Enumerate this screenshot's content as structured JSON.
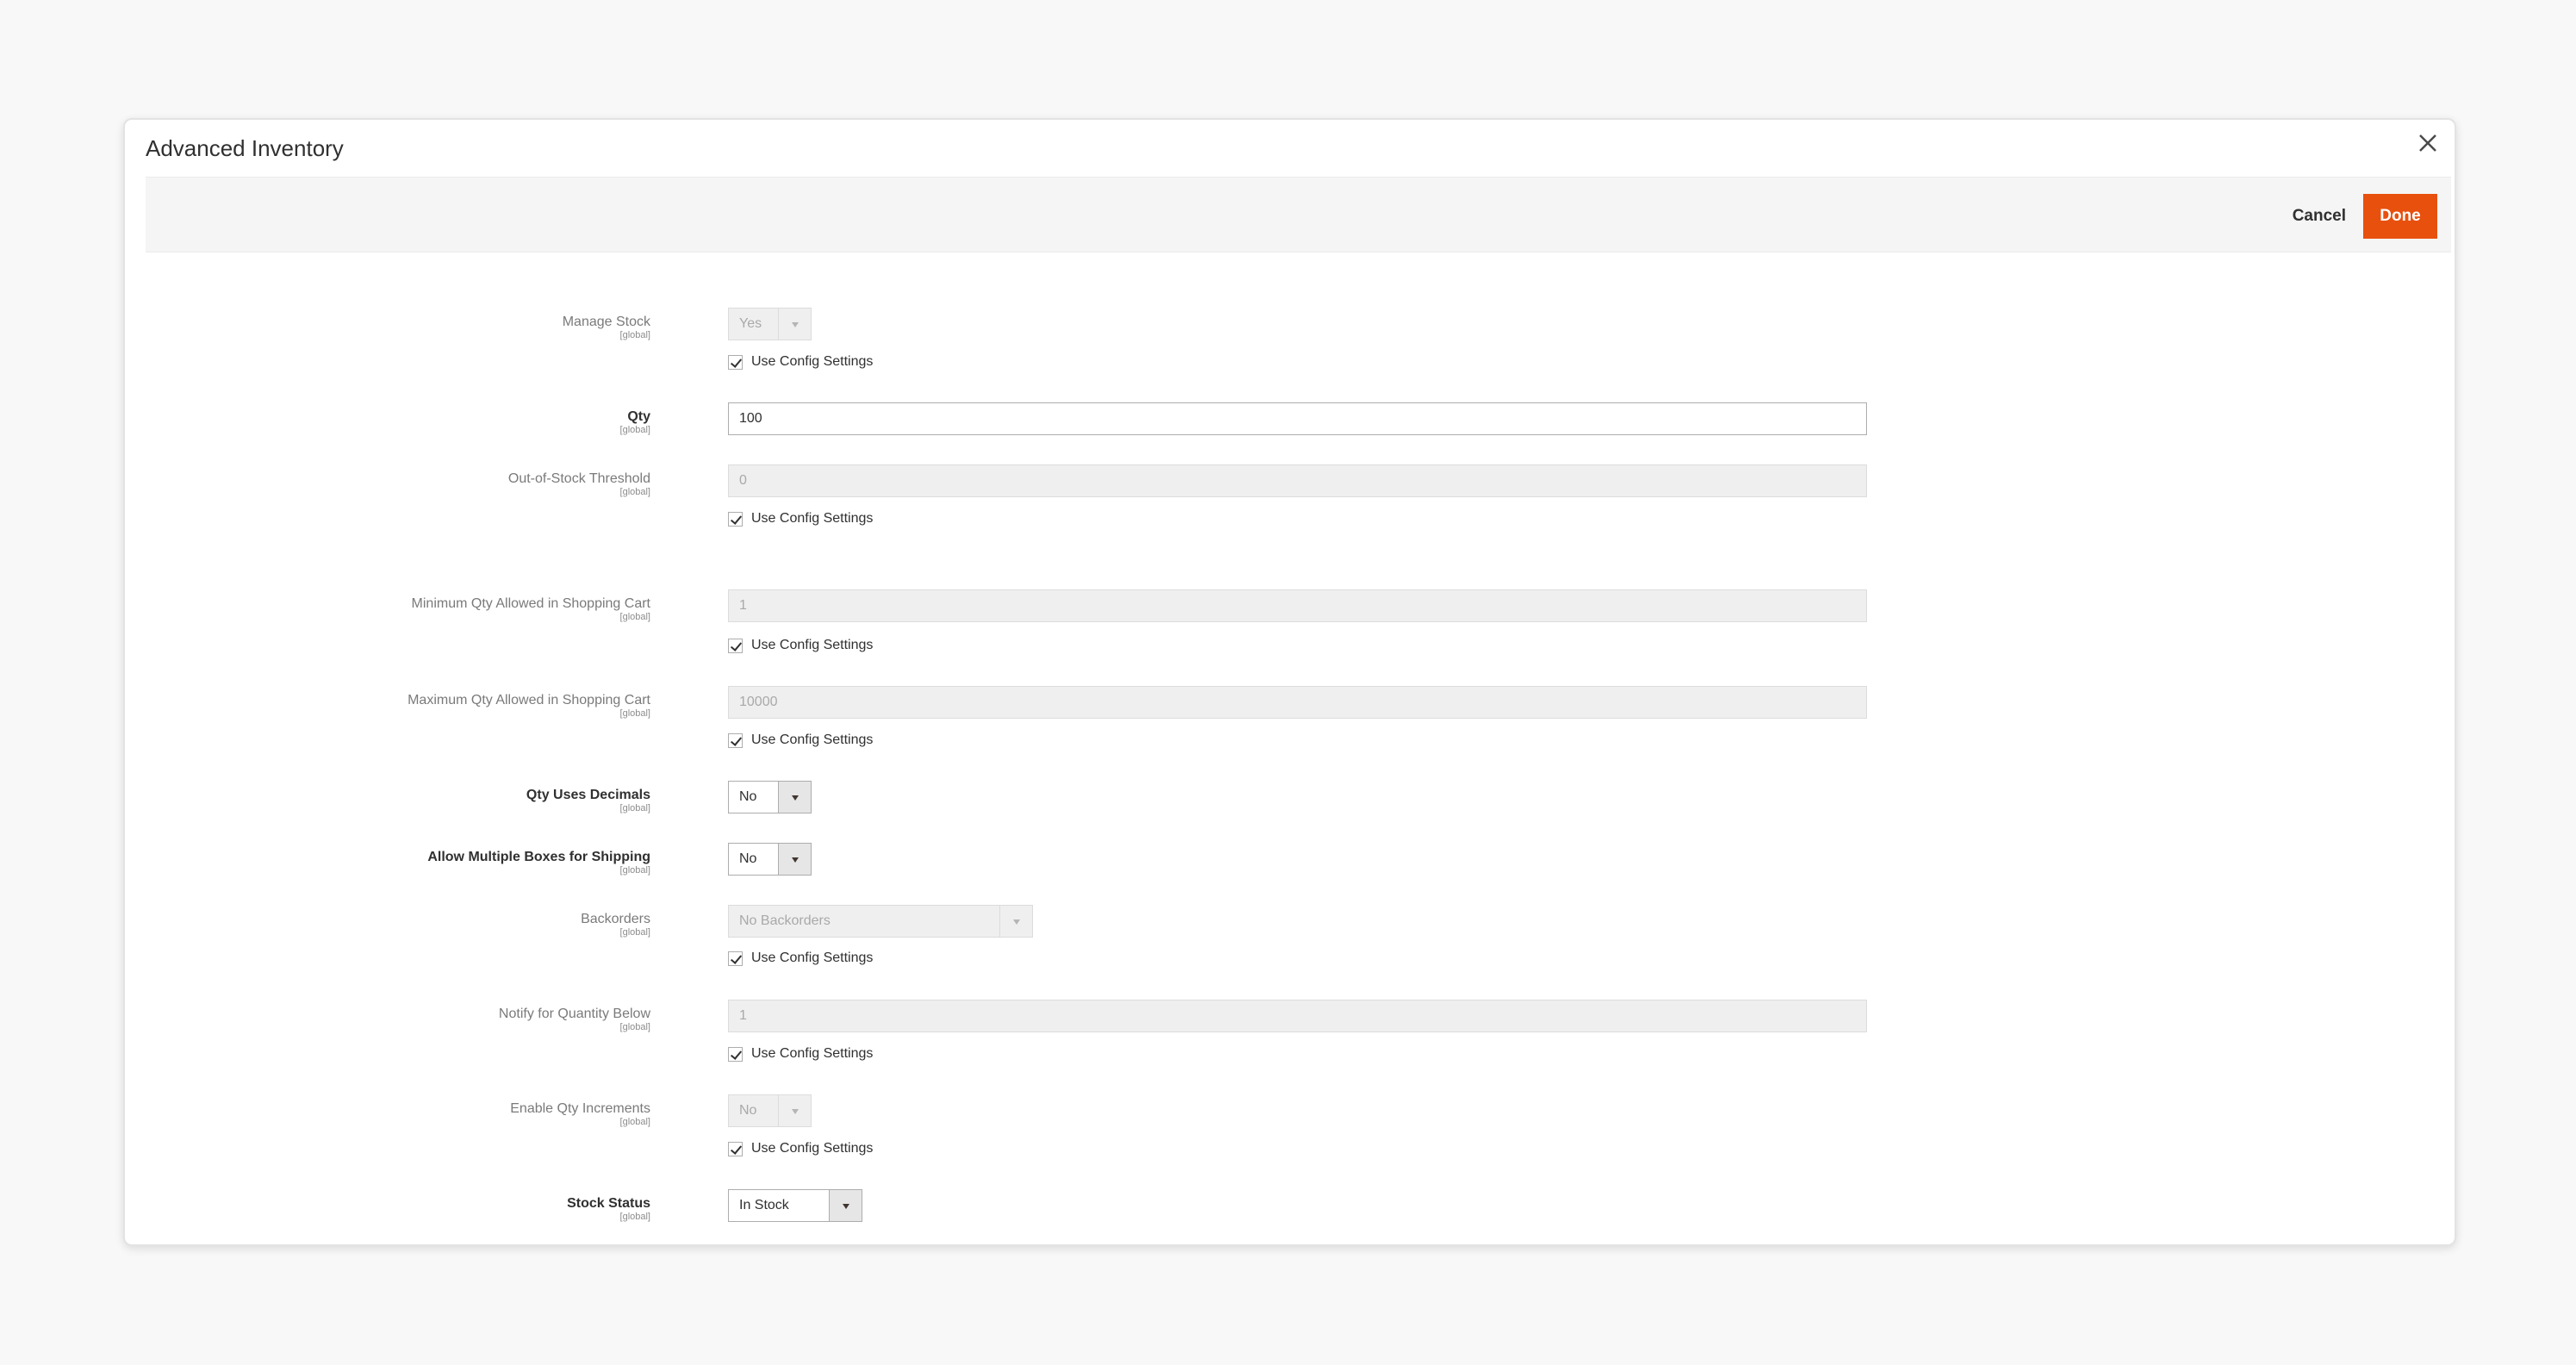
{
  "modal": {
    "title": "Advanced Inventory"
  },
  "actions": {
    "cancel_label": "Cancel",
    "done_label": "Done",
    "done_color": "#e8500e"
  },
  "use_config_label": "Use Config Settings",
  "scope_label": "[global]",
  "fields": {
    "manage_stock": {
      "label": "Manage Stock",
      "value": "Yes",
      "disabled": true,
      "use_config": true
    },
    "qty": {
      "label": "Qty",
      "value": "100",
      "disabled": false
    },
    "out_of_stock_threshold": {
      "label": "Out-of-Stock Threshold",
      "value": "0",
      "disabled": true,
      "use_config": true
    },
    "min_qty_cart": {
      "label": "Minimum Qty Allowed in Shopping Cart",
      "value": "1",
      "disabled": true,
      "use_config": true
    },
    "max_qty_cart": {
      "label": "Maximum Qty Allowed in Shopping Cart",
      "value": "10000",
      "disabled": true,
      "use_config": true
    },
    "qty_uses_decimals": {
      "label": "Qty Uses Decimals",
      "value": "No",
      "disabled": false
    },
    "allow_multiple_boxes": {
      "label": "Allow Multiple Boxes for Shipping",
      "value": "No",
      "disabled": false
    },
    "backorders": {
      "label": "Backorders",
      "value": "No Backorders",
      "disabled": true,
      "use_config": true
    },
    "notify_qty_below": {
      "label": "Notify for Quantity Below",
      "value": "1",
      "disabled": true,
      "use_config": true
    },
    "enable_qty_increments": {
      "label": "Enable Qty Increments",
      "value": "No",
      "disabled": true,
      "use_config": true
    },
    "stock_status": {
      "label": "Stock Status",
      "value": "In Stock",
      "disabled": false
    }
  }
}
